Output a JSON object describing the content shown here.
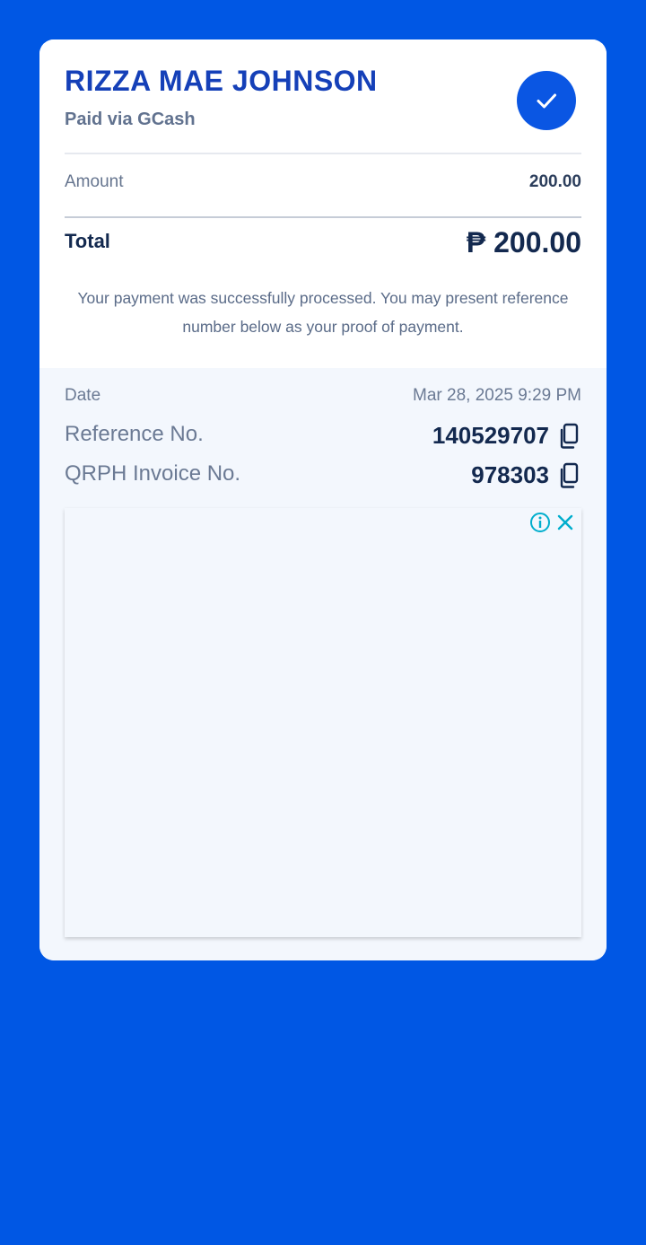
{
  "receipt": {
    "recipient_name": "RIZZA MAE JOHNSON",
    "payment_method": "Paid via GCash",
    "amount_label": "Amount",
    "amount_value": "200.00",
    "total_label": "Total",
    "total_value": "₱ 200.00",
    "message": "Your payment was successfully processed. You may present reference number below as your proof of payment."
  },
  "details": {
    "date_label": "Date",
    "date_value": "Mar 28, 2025 9:29 PM",
    "reference_label": "Reference No.",
    "reference_value": "140529707",
    "invoice_label": "QRPH Invoice No.",
    "invoice_value": "978303"
  },
  "icons": {
    "status": "check-icon",
    "copy": "copy-icon",
    "ad_info": "info-icon",
    "ad_close": "close-icon"
  },
  "colors": {
    "background": "#0057e4",
    "brand_blue": "#1540b8",
    "badge": "#0a56e3",
    "text_dark": "#13294f",
    "text_muted": "#6b7a94",
    "details_bg": "#f3f7fd",
    "ad_icon": "#00aecd"
  }
}
